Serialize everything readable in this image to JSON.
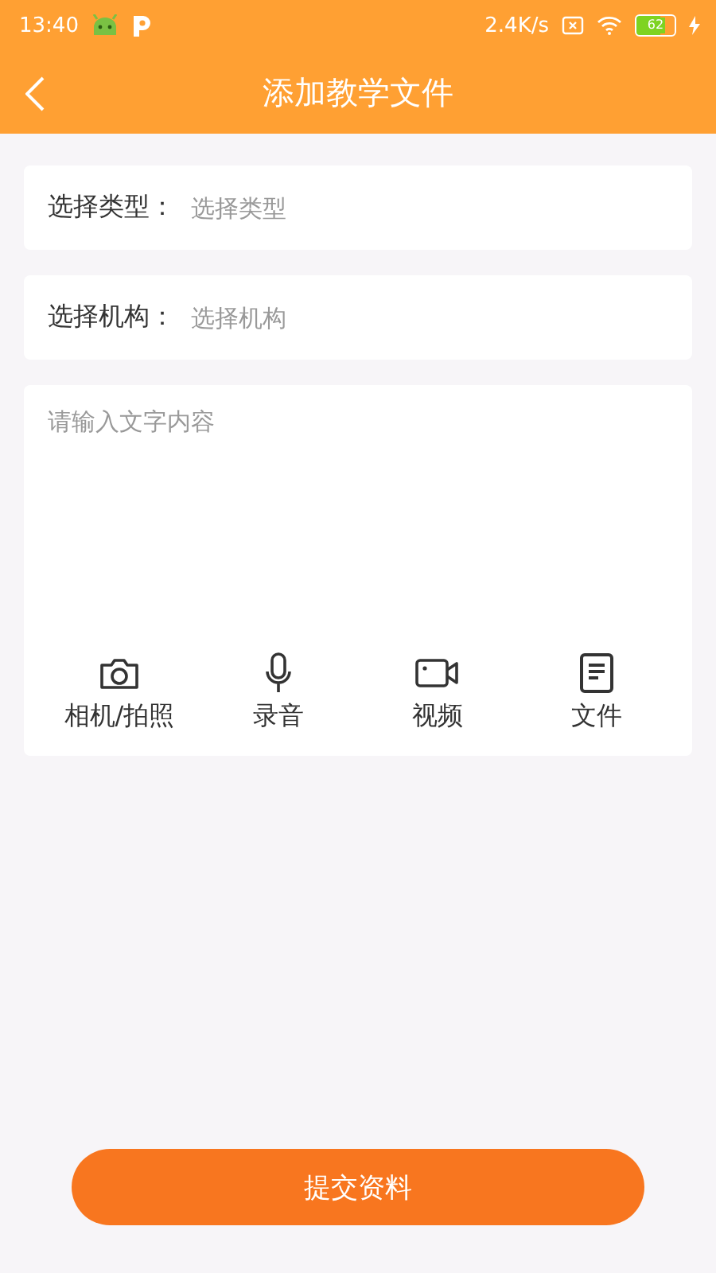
{
  "status_bar": {
    "time": "13:40",
    "net_speed": "2.4K/s",
    "battery": "62",
    "charging": true
  },
  "header": {
    "title": "添加教学文件"
  },
  "pickers": [
    {
      "label": "选择类型：",
      "placeholder": "选择类型"
    },
    {
      "label": "选择机构：",
      "placeholder": "选择机构"
    }
  ],
  "content": {
    "placeholder": "请输入文字内容"
  },
  "attachments": [
    {
      "kind": "camera",
      "label": "相机/拍照"
    },
    {
      "kind": "microphone",
      "label": "录音"
    },
    {
      "kind": "video",
      "label": "视频"
    },
    {
      "kind": "file",
      "label": "文件"
    }
  ],
  "submit": {
    "label": "提交资料"
  }
}
